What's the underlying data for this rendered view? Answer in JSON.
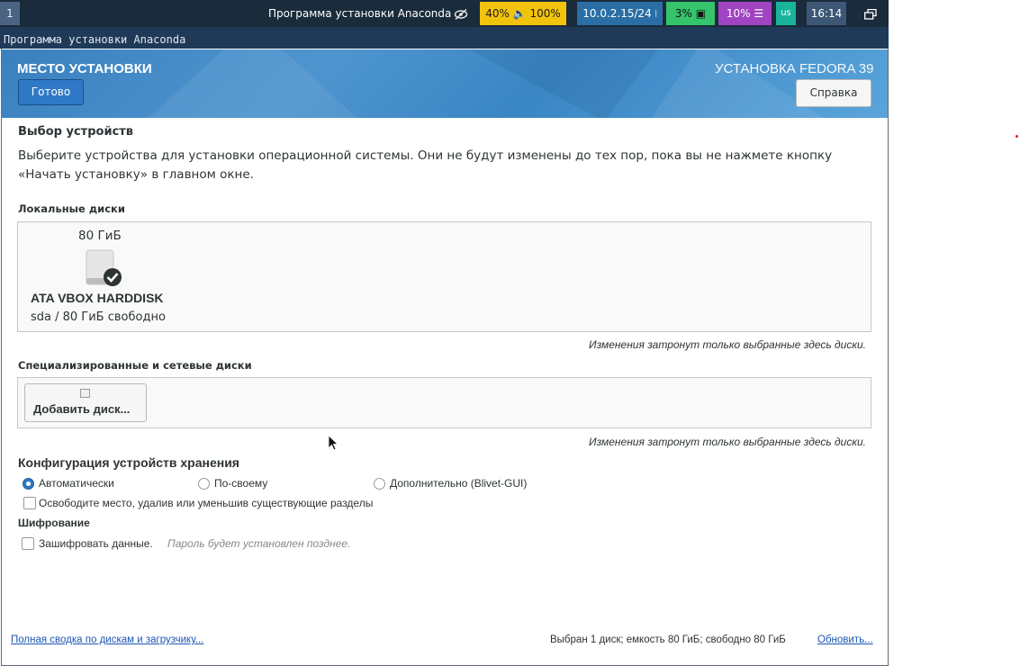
{
  "topbar": {
    "workspace": "1",
    "window_title": "Программа установки Anaconda",
    "volume": "40% 🔈 100%",
    "network": "10.0.2.15/24",
    "cpu": "3%",
    "memory": "10%",
    "layout": "us",
    "time": "16:14",
    "icons": {
      "privacy": "eye-slash-icon",
      "memory": "bars-icon",
      "cpu": "chip-icon",
      "network": "wifi-icon",
      "window": "windows-icon"
    }
  },
  "app_title": "Программа установки Anaconda",
  "header": {
    "title": "МЕСТО УСТАНОВКИ",
    "product": "УСТАНОВКА FEDORA 39",
    "done_label": "Готово",
    "help_label": "Справка",
    "colors": {
      "gradient_start": "#3a80bf",
      "gradient_end": "#5aa4db",
      "done_button": "#2e78c6"
    }
  },
  "devices": {
    "section_title": "Выбор устройств",
    "description": "Выберите устройства для установки операционной системы. Они не будут изменены до тех пор, пока вы не нажмете кнопку «Начать установку» в главном окне.",
    "local_title": "Локальные диски",
    "disk": {
      "size": "80 ГиБ",
      "name": "ATA VBOX HARDDISK",
      "free": "sda  /  80 ГиБ свободно"
    },
    "local_note": "Изменения затронут только выбранные здесь диски.",
    "specialized_title": "Специализированные и сетевые диски",
    "add_disk_label": "Добавить диск...",
    "specialized_note": "Изменения затронут только выбранные здесь диски."
  },
  "storage_config": {
    "title": "Конфигурация устройств хранения",
    "options": [
      "Автоматически",
      "По-своему",
      "Дополнительно (Blivet-GUI)"
    ],
    "selected": "Автоматически",
    "reclaim_label": "Освободите место, удалив или уменьшив существующие разделы",
    "reclaim_checked": false
  },
  "encryption": {
    "title": "Шифрование",
    "encrypt_label": "Зашифровать данные.",
    "hint": "Пароль будет установлен позднее.",
    "checked": false
  },
  "footer": {
    "summary_link": "Полная сводка по дискам и загрузчику...",
    "status": "Выбран 1 диск; емкость 80 ГиБ; свободно 80 ГиБ",
    "refresh_link": "Обновить..."
  }
}
